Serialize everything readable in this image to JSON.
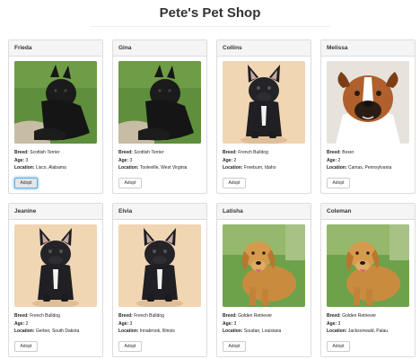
{
  "page_title": "Pete's Pet Shop",
  "labels": {
    "breed": "Breed:",
    "age": "Age:",
    "location": "Location:"
  },
  "adopt_label": "Adopt",
  "pets": [
    {
      "name": "Frieda",
      "breed": "Scottish Terrier",
      "age": "3",
      "location": "Lisco, Alabama",
      "photo": "scottish-terrier"
    },
    {
      "name": "Gina",
      "breed": "Scottish Terrier",
      "age": "3",
      "location": "Tooleville, West Virginia",
      "photo": "scottish-terrier"
    },
    {
      "name": "Collins",
      "breed": "French Bulldog",
      "age": "2",
      "location": "Freeburn, Idaho",
      "photo": "french-bulldog"
    },
    {
      "name": "Melissa",
      "breed": "Boxer",
      "age": "2",
      "location": "Camas, Pennsylvania",
      "photo": "boxer"
    },
    {
      "name": "Jeanine",
      "breed": "French Bulldog",
      "age": "2",
      "location": "Gerber, South Dakota",
      "photo": "french-bulldog"
    },
    {
      "name": "Elvia",
      "breed": "French Bulldog",
      "age": "3",
      "location": "Innabrook, Illinois",
      "photo": "french-bulldog"
    },
    {
      "name": "Latisha",
      "breed": "Golden Retriever",
      "age": "3",
      "location": "Soudan, Louisiana",
      "photo": "golden-retriever"
    },
    {
      "name": "Coleman",
      "breed": "Golden Retriever",
      "age": "3",
      "location": "Jacksonwald, Palau",
      "photo": "golden-retriever"
    }
  ]
}
